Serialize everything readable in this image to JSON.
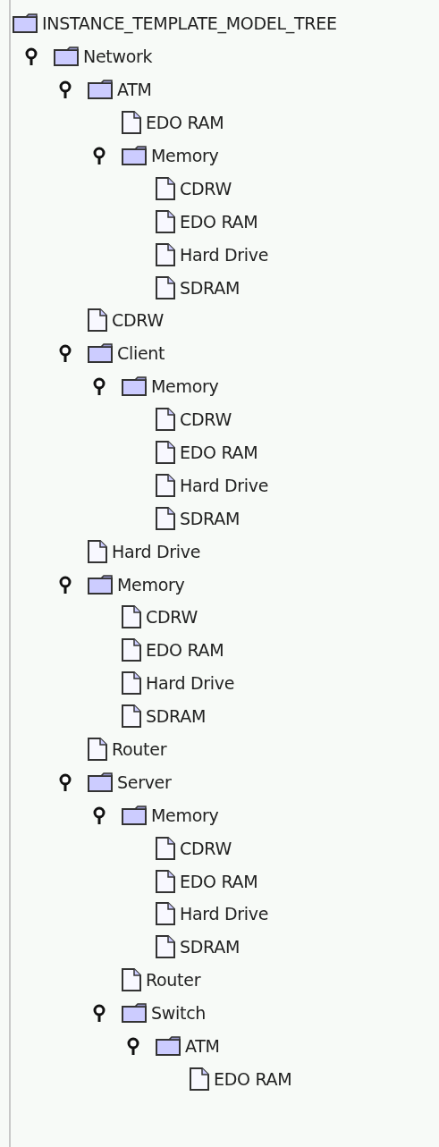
{
  "tree": {
    "label": "INSTANCE_TEMPLATE_MODEL_TREE",
    "kind": "folder",
    "children": [
      {
        "label": "Network",
        "kind": "folder",
        "expanded": true,
        "children": [
          {
            "label": "ATM",
            "kind": "folder",
            "expanded": true,
            "children": [
              {
                "label": "EDO RAM",
                "kind": "leaf"
              },
              {
                "label": "Memory",
                "kind": "folder",
                "expanded": true,
                "children": [
                  {
                    "label": "CDRW",
                    "kind": "leaf"
                  },
                  {
                    "label": "EDO RAM",
                    "kind": "leaf"
                  },
                  {
                    "label": "Hard Drive",
                    "kind": "leaf"
                  },
                  {
                    "label": "SDRAM",
                    "kind": "leaf"
                  }
                ]
              }
            ]
          },
          {
            "label": "CDRW",
            "kind": "leaf"
          },
          {
            "label": "Client",
            "kind": "folder",
            "expanded": true,
            "children": [
              {
                "label": "Memory",
                "kind": "folder",
                "expanded": true,
                "children": [
                  {
                    "label": "CDRW",
                    "kind": "leaf"
                  },
                  {
                    "label": "EDO RAM",
                    "kind": "leaf"
                  },
                  {
                    "label": "Hard Drive",
                    "kind": "leaf"
                  },
                  {
                    "label": "SDRAM",
                    "kind": "leaf"
                  }
                ]
              }
            ]
          },
          {
            "label": "Hard Drive",
            "kind": "leaf"
          },
          {
            "label": "Memory",
            "kind": "folder",
            "expanded": true,
            "children": [
              {
                "label": "CDRW",
                "kind": "leaf"
              },
              {
                "label": "EDO RAM",
                "kind": "leaf"
              },
              {
                "label": "Hard Drive",
                "kind": "leaf"
              },
              {
                "label": "SDRAM",
                "kind": "leaf"
              }
            ]
          },
          {
            "label": "Router",
            "kind": "leaf"
          },
          {
            "label": "Server",
            "kind": "folder",
            "expanded": true,
            "children": [
              {
                "label": "Memory",
                "kind": "folder",
                "expanded": true,
                "children": [
                  {
                    "label": "CDRW",
                    "kind": "leaf"
                  },
                  {
                    "label": "EDO RAM",
                    "kind": "leaf"
                  },
                  {
                    "label": "Hard Drive",
                    "kind": "leaf"
                  },
                  {
                    "label": "SDRAM",
                    "kind": "leaf"
                  }
                ]
              },
              {
                "label": "Router",
                "kind": "leaf"
              },
              {
                "label": "Switch",
                "kind": "folder",
                "expanded": true,
                "children": [
                  {
                    "label": "ATM",
                    "kind": "folder",
                    "expanded": true,
                    "children": [
                      {
                        "label": "EDO RAM",
                        "kind": "leaf"
                      }
                    ]
                  }
                ]
              }
            ]
          }
        ]
      }
    ]
  }
}
